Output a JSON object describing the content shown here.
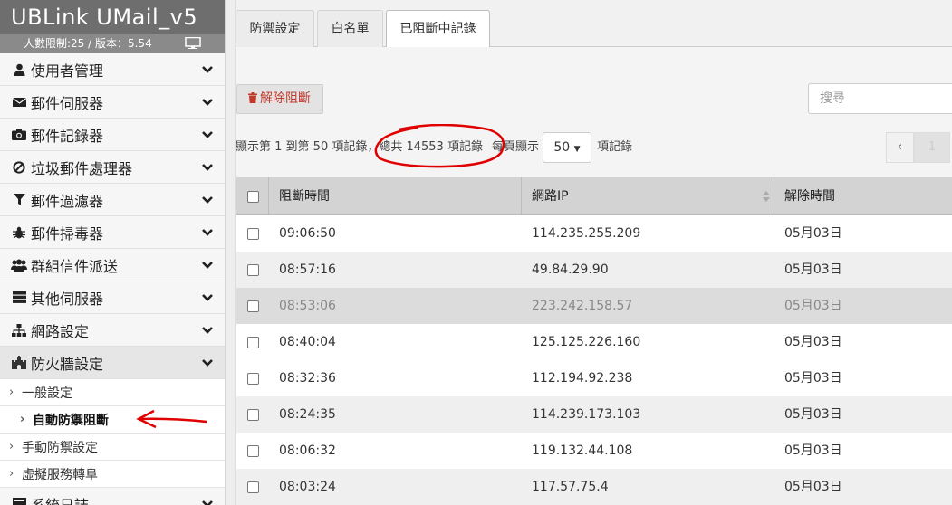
{
  "brand": {
    "title": "UBLink UMail_v5",
    "subtitle": "人數限制:25 / 版本：5.54"
  },
  "sidebar": {
    "items": [
      {
        "label": "使用者管理",
        "icon": "user-icon"
      },
      {
        "label": "郵件伺服器",
        "icon": "envelope-icon"
      },
      {
        "label": "郵件記錄器",
        "icon": "camera-icon"
      },
      {
        "label": "垃圾郵件處理器",
        "icon": "ban-icon"
      },
      {
        "label": "郵件過濾器",
        "icon": "filter-icon"
      },
      {
        "label": "郵件掃毒器",
        "icon": "bug-icon"
      },
      {
        "label": "群組信件派送",
        "icon": "users-icon"
      },
      {
        "label": "其他伺服器",
        "icon": "server-icon"
      },
      {
        "label": "網路設定",
        "icon": "sitemap-icon"
      },
      {
        "label": "防火牆設定",
        "icon": "castle-icon"
      }
    ],
    "sub_items": [
      "一般設定",
      "自動防禦阻斷",
      "手動防禦設定",
      "虛擬服務轉阜"
    ],
    "last_item": "系統日誌"
  },
  "tabs": [
    "防禦設定",
    "白名單",
    "已阻斷中記錄"
  ],
  "toolbar": {
    "unblock_label": "解除阻斷",
    "search_placeholder": "搜尋",
    "summary_prefix": "顯示第 1 到第 50 項記錄，",
    "summary_total": "總共 14553 項記錄",
    "per_page_label": "每頁顯示",
    "page_size": "50",
    "records_suffix": "項記錄"
  },
  "pager": {
    "prev": "‹",
    "current": "1"
  },
  "table": {
    "headers": [
      "阻斷時間",
      "網路IP",
      "解除時間"
    ],
    "rows": [
      {
        "time": "09:06:50",
        "ip": "114.235.255.209",
        "release": "05月03日"
      },
      {
        "time": "08:57:16",
        "ip": "49.84.29.90",
        "release": "05月03日"
      },
      {
        "time": "08:53:06",
        "ip": "223.242.158.57",
        "release": "05月03日"
      },
      {
        "time": "08:40:04",
        "ip": "125.125.226.160",
        "release": "05月03日"
      },
      {
        "time": "08:32:36",
        "ip": "112.194.92.238",
        "release": "05月03日"
      },
      {
        "time": "08:24:35",
        "ip": "114.239.173.103",
        "release": "05月03日"
      },
      {
        "time": "08:06:32",
        "ip": "119.132.44.108",
        "release": "05月03日"
      },
      {
        "time": "08:03:24",
        "ip": "117.57.75.4",
        "release": "05月03日"
      }
    ]
  },
  "colors": {
    "brand_bg": "#6e6e6e",
    "danger": "#c0392b",
    "annotation": "#e00000"
  }
}
